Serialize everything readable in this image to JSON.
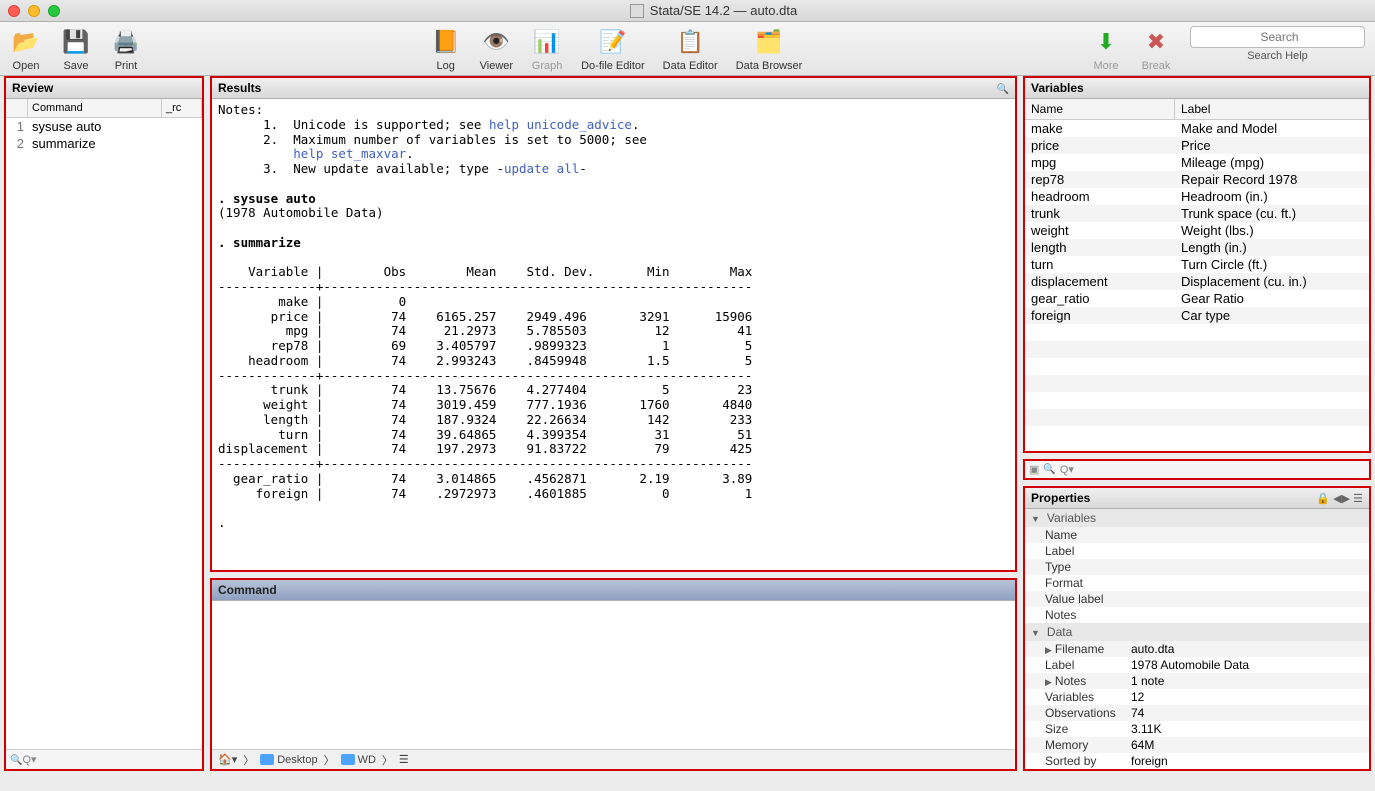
{
  "window": {
    "title": "Stata/SE 14.2 — auto.dta"
  },
  "toolbar": {
    "open": "Open",
    "save": "Save",
    "print": "Print",
    "log": "Log",
    "viewer": "Viewer",
    "graph": "Graph",
    "dofile": "Do-file Editor",
    "dataeditor": "Data Editor",
    "databrowser": "Data Browser",
    "more": "More",
    "break": "Break",
    "search_placeholder": "Search",
    "search_help": "Search Help"
  },
  "review": {
    "title": "Review",
    "headers": {
      "cmd": "Command",
      "rc": "_rc"
    },
    "items": [
      {
        "n": "1",
        "cmd": "sysuse auto"
      },
      {
        "n": "2",
        "cmd": "summarize"
      }
    ],
    "filter_placeholder": "Q▾"
  },
  "results": {
    "title": "Results",
    "notes_label": "Notes:",
    "notes": [
      {
        "pre": "      1.  Unicode is supported; see ",
        "link": "help unicode_advice",
        "post": "."
      },
      {
        "pre": "      2.  Maximum number of variables is set to 5000; see\n          ",
        "link": "help set_maxvar",
        "post": "."
      },
      {
        "pre": "      3.  New update available; type -",
        "link": "update all",
        "post": "-"
      }
    ],
    "cmd1": ". sysuse auto",
    "cmd1_out": "(1978 Automobile Data)",
    "cmd2": ". summarize",
    "table_header": "    Variable |        Obs        Mean    Std. Dev.       Min        Max",
    "table_rule": "-------------+---------------------------------------------------------",
    "table_sep": "-------------+---------------------------------------------------------",
    "rows1": [
      "        make |          0",
      "       price |         74    6165.257    2949.496       3291      15906",
      "         mpg |         74     21.2973    5.785503         12         41",
      "       rep78 |         69    3.405797    .9899323          1          5",
      "    headroom |         74    2.993243    .8459948        1.5          5"
    ],
    "rows2": [
      "       trunk |         74    13.75676    4.277404          5         23",
      "      weight |         74    3019.459    777.1936       1760       4840",
      "      length |         74    187.9324    22.26634        142        233",
      "        turn |         74    39.64865    4.399354         31         51",
      "displacement |         74    197.2973    91.83722         79        425"
    ],
    "rows3": [
      "  gear_ratio |         74    3.014865    .4562871       2.19       3.89",
      "     foreign |         74    .2972973    .4601885          0          1"
    ],
    "prompt": "."
  },
  "command": {
    "title": "Command"
  },
  "breadcrumb": {
    "desktop": "Desktop",
    "wd": "WD"
  },
  "variables": {
    "title": "Variables",
    "headers": {
      "name": "Name",
      "label": "Label"
    },
    "items": [
      {
        "name": "make",
        "label": "Make and Model"
      },
      {
        "name": "price",
        "label": "Price"
      },
      {
        "name": "mpg",
        "label": "Mileage (mpg)"
      },
      {
        "name": "rep78",
        "label": "Repair Record 1978"
      },
      {
        "name": "headroom",
        "label": "Headroom (in.)"
      },
      {
        "name": "trunk",
        "label": "Trunk space (cu. ft.)"
      },
      {
        "name": "weight",
        "label": "Weight (lbs.)"
      },
      {
        "name": "length",
        "label": "Length (in.)"
      },
      {
        "name": "turn",
        "label": "Turn Circle (ft.)"
      },
      {
        "name": "displacement",
        "label": "Displacement (cu. in.)"
      },
      {
        "name": "gear_ratio",
        "label": "Gear Ratio"
      },
      {
        "name": "foreign",
        "label": "Car type"
      }
    ],
    "filter_placeholder": "Q▾"
  },
  "properties": {
    "title": "Properties",
    "sections": {
      "variables": "Variables",
      "data": "Data"
    },
    "var_fields": {
      "name": "Name",
      "label": "Label",
      "type": "Type",
      "format": "Format",
      "value_label": "Value label",
      "notes": "Notes"
    },
    "data_fields": {
      "filename": "Filename",
      "label": "Label",
      "notes": "Notes",
      "variables": "Variables",
      "observations": "Observations",
      "size": "Size",
      "memory": "Memory",
      "sorted_by": "Sorted by"
    },
    "data_values": {
      "filename": "auto.dta",
      "label": "1978 Automobile Data",
      "notes": "1 note",
      "variables": "12",
      "observations": "74",
      "size": "3.11K",
      "memory": "64M",
      "sorted_by": "foreign"
    }
  }
}
